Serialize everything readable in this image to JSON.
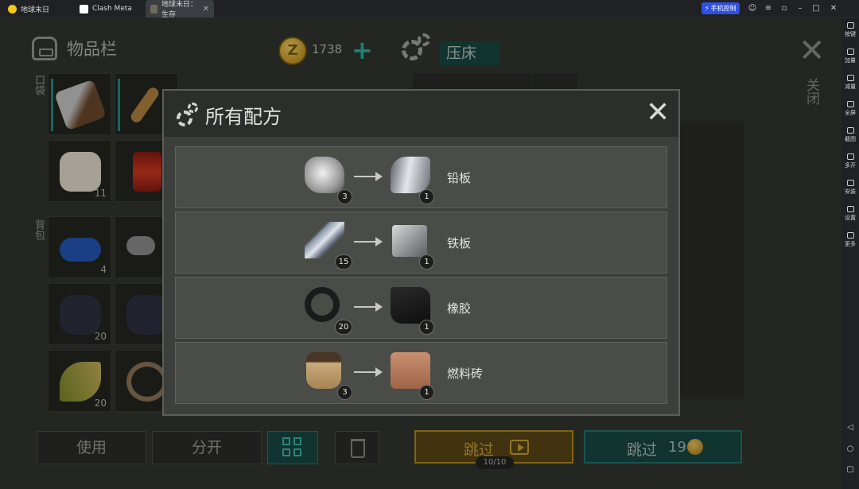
{
  "titlebar": {
    "tabs": [
      {
        "label": "地球末日"
      },
      {
        "label": "Clash Meta"
      },
      {
        "label": "地球末日：生存"
      }
    ],
    "phone_control": "手机控制"
  },
  "sidebar": {
    "items": [
      {
        "label": "按键"
      },
      {
        "label": "加量"
      },
      {
        "label": "减量"
      },
      {
        "label": "全屏"
      },
      {
        "label": "截图"
      },
      {
        "label": "多开"
      },
      {
        "label": "安装"
      },
      {
        "label": "设置"
      },
      {
        "label": "更多"
      }
    ]
  },
  "inventory": {
    "title": "物品栏",
    "pocket_label": "口袋",
    "backpack_label": "背包",
    "slots": [
      {
        "count": ""
      },
      {
        "count": ""
      },
      {
        "count": "11"
      },
      {
        "count": ""
      },
      {
        "count": "4"
      },
      {
        "count": ""
      },
      {
        "count": "20"
      },
      {
        "count": ""
      },
      {
        "count": "20"
      },
      {
        "count": ""
      }
    ]
  },
  "currency": {
    "coins": "1738",
    "add": "+"
  },
  "crafting": {
    "station": "压床",
    "close_label": "关闭"
  },
  "bottom": {
    "use": "使用",
    "split": "分开",
    "skip_ad": "跳过",
    "skip_ad_count": "10/10",
    "skip_coin": "跳过",
    "skip_coin_cost": "19"
  },
  "modal": {
    "title": "所有配方",
    "recipes": [
      {
        "input_count": "3",
        "output_count": "1",
        "name": "铅板"
      },
      {
        "input_count": "15",
        "output_count": "1",
        "name": "铁板"
      },
      {
        "input_count": "20",
        "output_count": "1",
        "name": "橡胶"
      },
      {
        "input_count": "3",
        "output_count": "1",
        "name": "燃料砖"
      }
    ]
  }
}
